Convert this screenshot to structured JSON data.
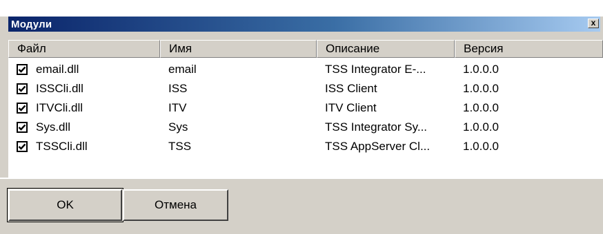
{
  "window": {
    "title": "Модули",
    "close_glyph": "x"
  },
  "columns": [
    "Файл",
    "Имя",
    "Описание",
    "Версия"
  ],
  "rows": [
    {
      "checked": true,
      "file": "email.dll",
      "name": "email",
      "description": "TSS Integrator E-...",
      "version": "1.0.0.0"
    },
    {
      "checked": true,
      "file": "ISSCli.dll",
      "name": "ISS",
      "description": "ISS Client",
      "version": "1.0.0.0"
    },
    {
      "checked": true,
      "file": "ITVCli.dll",
      "name": "ITV",
      "description": "ITV Client",
      "version": "1.0.0.0"
    },
    {
      "checked": true,
      "file": "Sys.dll",
      "name": "Sys",
      "description": "TSS Integrator Sy...",
      "version": "1.0.0.0"
    },
    {
      "checked": true,
      "file": "TSSCli.dll",
      "name": "TSS",
      "description": "TSS AppServer Cl...",
      "version": "1.0.0.0"
    }
  ],
  "buttons": {
    "ok": "OK",
    "cancel": "Отмена"
  },
  "colors": {
    "title_start": "#0a246a",
    "title_end": "#a6caf0",
    "face": "#d4d0c8"
  }
}
